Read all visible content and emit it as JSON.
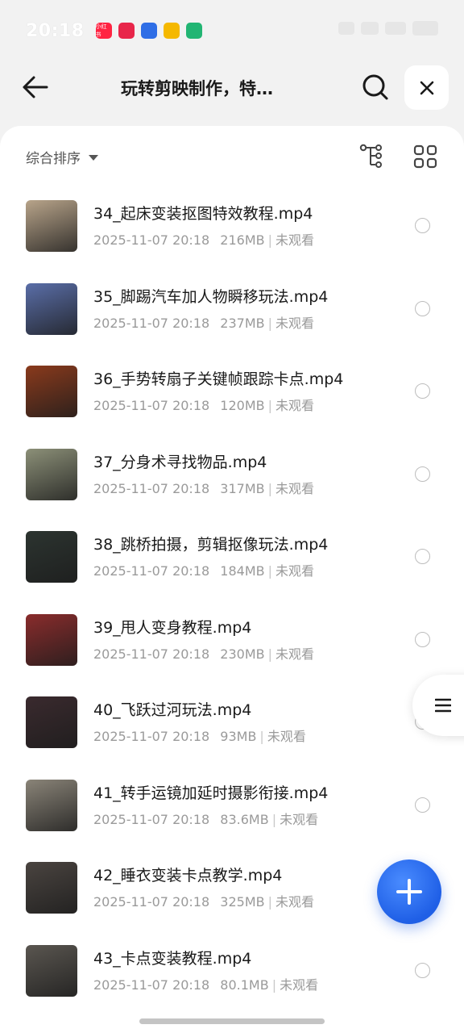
{
  "status_bar": {
    "time": "20:18",
    "app_icons": [
      {
        "name": "xiaohongshu-icon",
        "color": "#ff2442",
        "label": "小红书"
      },
      {
        "name": "app-red-icon",
        "color": "#e8264a",
        "label": ""
      },
      {
        "name": "baidu-icon",
        "color": "#2f6ee6",
        "label": ""
      },
      {
        "name": "mail-icon",
        "color": "#f5b800",
        "label": ""
      },
      {
        "name": "recycle-icon",
        "color": "#22b573",
        "label": ""
      }
    ]
  },
  "header": {
    "title": "玩转剪映制作，特…",
    "back_icon": "arrow-left-icon",
    "search_icon": "search-icon",
    "close_icon": "close-icon"
  },
  "toolbar": {
    "sort_label": "综合排序",
    "tree_icon": "tree-view-icon",
    "grid_icon": "grid-view-icon"
  },
  "files": [
    {
      "name": "34_起床变装抠图特效教程.mp4",
      "date": "2025-11-07 20:18",
      "size": "216MB",
      "status": "未观看",
      "thumb_color": "#b8a48a"
    },
    {
      "name": "35_脚踢汽车加人物瞬移玩法.mp4",
      "date": "2025-11-07 20:18",
      "size": "237MB",
      "status": "未观看",
      "thumb_color": "#5a6ea8"
    },
    {
      "name": "36_手势转扇子关键帧跟踪卡点.mp4",
      "date": "2025-11-07 20:18",
      "size": "120MB",
      "status": "未观看",
      "thumb_color": "#8a3a1c"
    },
    {
      "name": "37_分身术寻找物品.mp4",
      "date": "2025-11-07 20:18",
      "size": "317MB",
      "status": "未观看",
      "thumb_color": "#8c9078"
    },
    {
      "name": "38_跳桥拍摄，剪辑抠像玩法.mp4",
      "date": "2025-11-07 20:18",
      "size": "184MB",
      "status": "未观看",
      "thumb_color": "#2c3430"
    },
    {
      "name": "39_甩人变身教程.mp4",
      "date": "2025-11-07 20:18",
      "size": "230MB",
      "status": "未观看",
      "thumb_color": "#8a2c2c"
    },
    {
      "name": "40_飞跃过河玩法.mp4",
      "date": "2025-11-07 20:18",
      "size": "93MB",
      "status": "未观看",
      "thumb_color": "#3a2a2e"
    },
    {
      "name": "41_转手运镜加延时摄影衔接.mp4",
      "date": "2025-11-07 20:18",
      "size": "83.6MB",
      "status": "未观看",
      "thumb_color": "#8a8478"
    },
    {
      "name": "42_睡衣变装卡点教学.mp4",
      "date": "2025-11-07 20:18",
      "size": "325MB",
      "status": "未观看",
      "thumb_color": "#4a4440"
    },
    {
      "name": "43_卡点变装教程.mp4",
      "date": "2025-11-07 20:18",
      "size": "80.1MB",
      "status": "未观看",
      "thumb_color": "#5a5650"
    }
  ],
  "floating": {
    "menu_icon": "menu-icon",
    "add_icon": "plus-icon",
    "fab_color": "#2b6ff0"
  }
}
